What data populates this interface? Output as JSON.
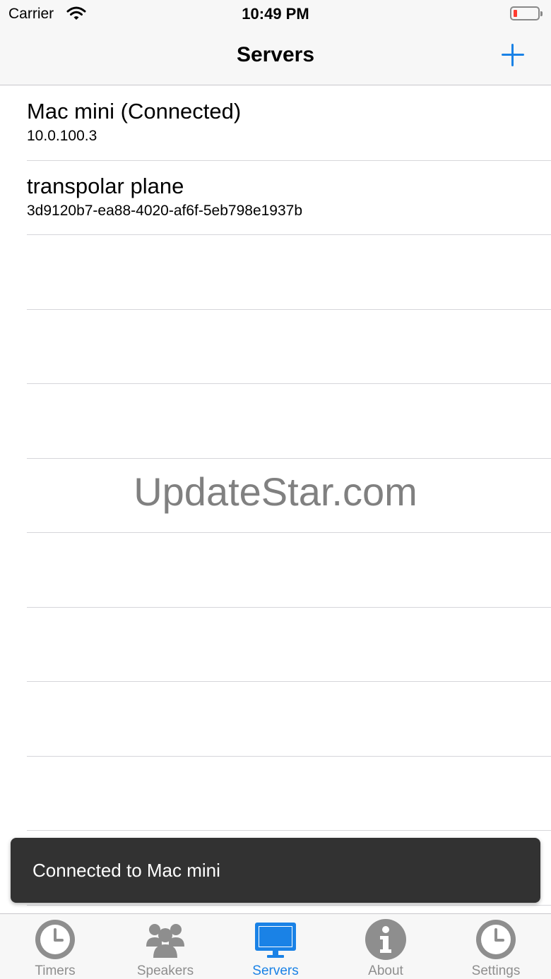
{
  "status_bar": {
    "carrier": "Carrier",
    "time": "10:49 PM",
    "battery_color": "#ff3b30"
  },
  "nav": {
    "title": "Servers",
    "add_icon": "plus-icon",
    "accent": "#1a82e6"
  },
  "servers": [
    {
      "title": "Mac mini (Connected)",
      "subtitle": "10.0.100.3"
    },
    {
      "title": "transpolar plane",
      "subtitle": "3d9120b7-ea88-4020-af6f-5eb798e1937b"
    }
  ],
  "watermark": "UpdateStar.com",
  "toast": {
    "message": "Connected to Mac mini"
  },
  "tabs": [
    {
      "label": "Timers",
      "icon": "clock-icon",
      "active": false
    },
    {
      "label": "Speakers",
      "icon": "people-icon",
      "active": false
    },
    {
      "label": "Servers",
      "icon": "monitor-icon",
      "active": true
    },
    {
      "label": "About",
      "icon": "info-icon",
      "active": false
    },
    {
      "label": "Settings",
      "icon": "clock-icon",
      "active": false
    }
  ]
}
